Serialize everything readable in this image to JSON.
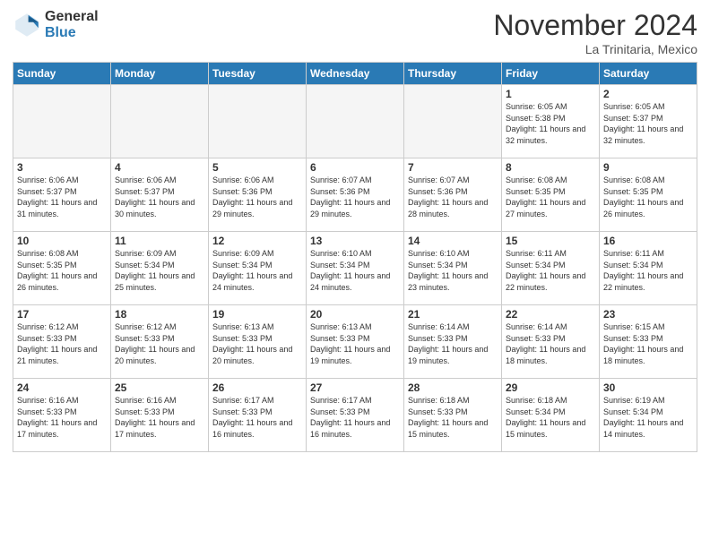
{
  "header": {
    "logo_general": "General",
    "logo_blue": "Blue",
    "month_title": "November 2024",
    "location": "La Trinitaria, Mexico"
  },
  "weekdays": [
    "Sunday",
    "Monday",
    "Tuesday",
    "Wednesday",
    "Thursday",
    "Friday",
    "Saturday"
  ],
  "weeks": [
    [
      {
        "day": "",
        "empty": true
      },
      {
        "day": "",
        "empty": true
      },
      {
        "day": "",
        "empty": true
      },
      {
        "day": "",
        "empty": true
      },
      {
        "day": "",
        "empty": true
      },
      {
        "day": "1",
        "sunrise": "6:05 AM",
        "sunset": "5:38 PM",
        "daylight": "11 hours and 32 minutes."
      },
      {
        "day": "2",
        "sunrise": "6:05 AM",
        "sunset": "5:37 PM",
        "daylight": "11 hours and 32 minutes."
      }
    ],
    [
      {
        "day": "3",
        "sunrise": "6:06 AM",
        "sunset": "5:37 PM",
        "daylight": "11 hours and 31 minutes."
      },
      {
        "day": "4",
        "sunrise": "6:06 AM",
        "sunset": "5:37 PM",
        "daylight": "11 hours and 30 minutes."
      },
      {
        "day": "5",
        "sunrise": "6:06 AM",
        "sunset": "5:36 PM",
        "daylight": "11 hours and 29 minutes."
      },
      {
        "day": "6",
        "sunrise": "6:07 AM",
        "sunset": "5:36 PM",
        "daylight": "11 hours and 29 minutes."
      },
      {
        "day": "7",
        "sunrise": "6:07 AM",
        "sunset": "5:36 PM",
        "daylight": "11 hours and 28 minutes."
      },
      {
        "day": "8",
        "sunrise": "6:08 AM",
        "sunset": "5:35 PM",
        "daylight": "11 hours and 27 minutes."
      },
      {
        "day": "9",
        "sunrise": "6:08 AM",
        "sunset": "5:35 PM",
        "daylight": "11 hours and 26 minutes."
      }
    ],
    [
      {
        "day": "10",
        "sunrise": "6:08 AM",
        "sunset": "5:35 PM",
        "daylight": "11 hours and 26 minutes."
      },
      {
        "day": "11",
        "sunrise": "6:09 AM",
        "sunset": "5:34 PM",
        "daylight": "11 hours and 25 minutes."
      },
      {
        "day": "12",
        "sunrise": "6:09 AM",
        "sunset": "5:34 PM",
        "daylight": "11 hours and 24 minutes."
      },
      {
        "day": "13",
        "sunrise": "6:10 AM",
        "sunset": "5:34 PM",
        "daylight": "11 hours and 24 minutes."
      },
      {
        "day": "14",
        "sunrise": "6:10 AM",
        "sunset": "5:34 PM",
        "daylight": "11 hours and 23 minutes."
      },
      {
        "day": "15",
        "sunrise": "6:11 AM",
        "sunset": "5:34 PM",
        "daylight": "11 hours and 22 minutes."
      },
      {
        "day": "16",
        "sunrise": "6:11 AM",
        "sunset": "5:34 PM",
        "daylight": "11 hours and 22 minutes."
      }
    ],
    [
      {
        "day": "17",
        "sunrise": "6:12 AM",
        "sunset": "5:33 PM",
        "daylight": "11 hours and 21 minutes."
      },
      {
        "day": "18",
        "sunrise": "6:12 AM",
        "sunset": "5:33 PM",
        "daylight": "11 hours and 20 minutes."
      },
      {
        "day": "19",
        "sunrise": "6:13 AM",
        "sunset": "5:33 PM",
        "daylight": "11 hours and 20 minutes."
      },
      {
        "day": "20",
        "sunrise": "6:13 AM",
        "sunset": "5:33 PM",
        "daylight": "11 hours and 19 minutes."
      },
      {
        "day": "21",
        "sunrise": "6:14 AM",
        "sunset": "5:33 PM",
        "daylight": "11 hours and 19 minutes."
      },
      {
        "day": "22",
        "sunrise": "6:14 AM",
        "sunset": "5:33 PM",
        "daylight": "11 hours and 18 minutes."
      },
      {
        "day": "23",
        "sunrise": "6:15 AM",
        "sunset": "5:33 PM",
        "daylight": "11 hours and 18 minutes."
      }
    ],
    [
      {
        "day": "24",
        "sunrise": "6:16 AM",
        "sunset": "5:33 PM",
        "daylight": "11 hours and 17 minutes."
      },
      {
        "day": "25",
        "sunrise": "6:16 AM",
        "sunset": "5:33 PM",
        "daylight": "11 hours and 17 minutes."
      },
      {
        "day": "26",
        "sunrise": "6:17 AM",
        "sunset": "5:33 PM",
        "daylight": "11 hours and 16 minutes."
      },
      {
        "day": "27",
        "sunrise": "6:17 AM",
        "sunset": "5:33 PM",
        "daylight": "11 hours and 16 minutes."
      },
      {
        "day": "28",
        "sunrise": "6:18 AM",
        "sunset": "5:33 PM",
        "daylight": "11 hours and 15 minutes."
      },
      {
        "day": "29",
        "sunrise": "6:18 AM",
        "sunset": "5:34 PM",
        "daylight": "11 hours and 15 minutes."
      },
      {
        "day": "30",
        "sunrise": "6:19 AM",
        "sunset": "5:34 PM",
        "daylight": "11 hours and 14 minutes."
      }
    ]
  ]
}
